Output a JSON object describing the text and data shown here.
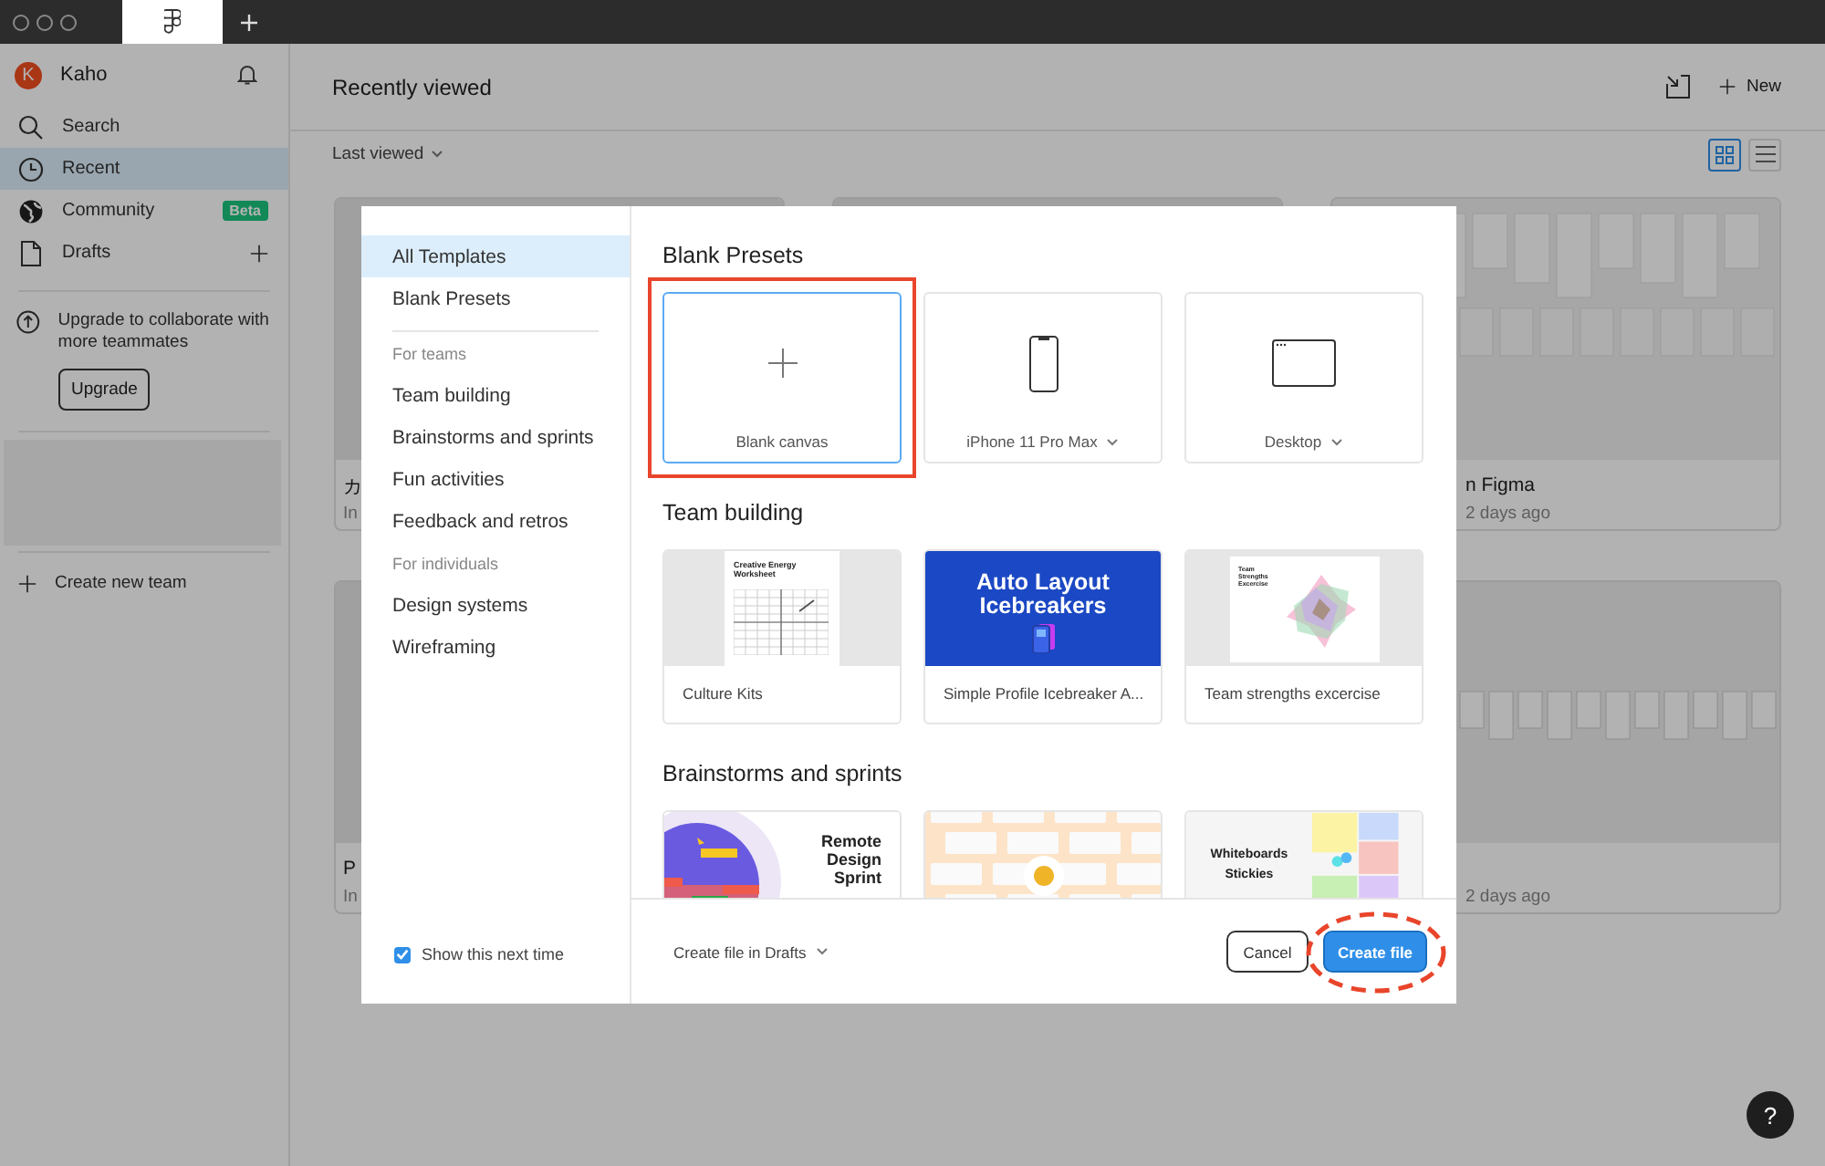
{
  "tabs": [
    {
      "kind": "home",
      "selected": true
    }
  ],
  "sidebar": {
    "user": {
      "initial": "K",
      "name": "Kaho"
    },
    "nav": [
      {
        "kind": "search",
        "label": "Search",
        "selected": false
      },
      {
        "kind": "recent",
        "label": "Recent",
        "selected": true
      },
      {
        "kind": "community",
        "label": "Community",
        "selected": false,
        "badge": "Beta"
      },
      {
        "kind": "drafts",
        "label": "Drafts",
        "selected": false
      }
    ],
    "upgrade": {
      "text": "Upgrade to collaborate with more teammates",
      "button": "Upgrade"
    },
    "create_team": "Create new team"
  },
  "main": {
    "title": "Recently viewed",
    "new_button": "New",
    "sort": "Last viewed",
    "views": [
      {
        "kind": "grid",
        "selected": true
      },
      {
        "kind": "list",
        "selected": false
      }
    ],
    "files": [
      {
        "kind": "blank",
        "title": "カ",
        "subtitle": "In"
      },
      {
        "kind": "blank"
      },
      {
        "kind": "frames",
        "title": "n Figma",
        "subtitle": "2 days ago"
      },
      {
        "kind": "blank",
        "title": "P",
        "subtitle": "In"
      },
      {
        "kind": "strip",
        "subtitle": "2 days ago"
      }
    ]
  },
  "modal": {
    "nav": {
      "top": [
        {
          "label": "All Templates",
          "selected": true
        },
        {
          "label": "Blank Presets",
          "selected": false
        }
      ],
      "sections": [
        {
          "heading": "For teams",
          "items": [
            {
              "label": "Team building",
              "selected": false
            },
            {
              "label": "Brainstorms and sprints",
              "selected": false
            },
            {
              "label": "Fun activities",
              "selected": false
            },
            {
              "label": "Feedback and retros",
              "selected": false
            }
          ]
        },
        {
          "heading": "For individuals",
          "items": [
            {
              "label": "Design systems",
              "selected": false
            },
            {
              "label": "Wireframing",
              "selected": false
            }
          ]
        }
      ]
    },
    "show_next_time": {
      "label": "Show this next time",
      "checked": true
    },
    "sections": [
      {
        "title": "Blank Presets",
        "templates": [
          {
            "kind": "blank",
            "label": "Blank canvas",
            "selected": true,
            "dropdown": false,
            "annotated": true
          },
          {
            "kind": "phone",
            "label": "iPhone 11 Pro Max",
            "selected": false,
            "dropdown": true
          },
          {
            "kind": "desktop",
            "label": "Desktop",
            "selected": false,
            "dropdown": true
          }
        ]
      },
      {
        "title": "Team building",
        "templates": [
          {
            "kind": "worksheet",
            "label": "Culture Kits",
            "selected": false,
            "thumb_texts": [
              "Creative Energy Worksheet"
            ]
          },
          {
            "kind": "banner",
            "label": "Simple Profile Icebreaker A...",
            "selected": false,
            "thumb_texts": [
              "Auto Layout Icebreakers"
            ]
          },
          {
            "kind": "radar",
            "label": "Team strengths excercise",
            "selected": false,
            "thumb_texts": [
              "Team Strengths Excercise"
            ]
          }
        ]
      },
      {
        "title": "Brainstorms and sprints",
        "templates": [
          {
            "kind": "sprint",
            "selected": false,
            "thumb_texts": [
              "Remote Design Sprint"
            ]
          },
          {
            "kind": "board",
            "selected": false
          },
          {
            "kind": "whiteboard",
            "selected": false,
            "thumb_texts": [
              "Whiteboards",
              "Stickies"
            ]
          }
        ]
      }
    ],
    "footer": {
      "location": "Create file in Drafts",
      "cancel": "Cancel",
      "create": "Create file",
      "create_annotated": true
    }
  },
  "help": "?"
}
